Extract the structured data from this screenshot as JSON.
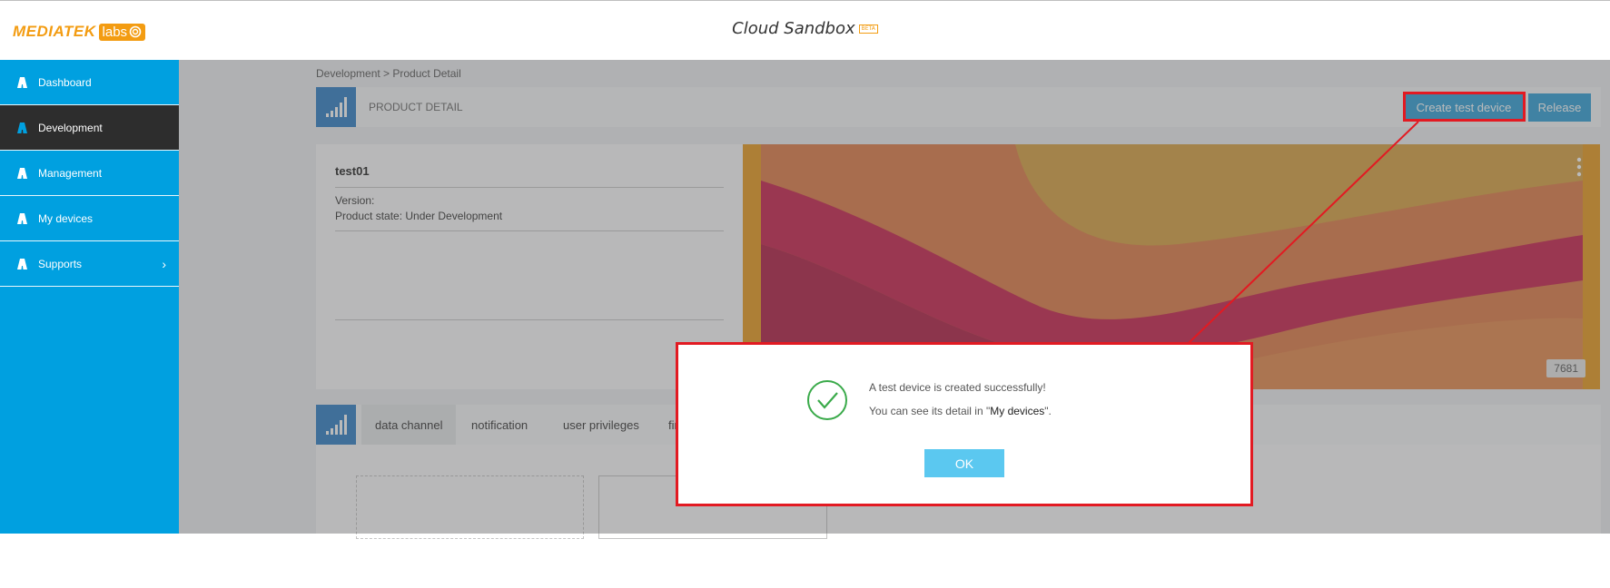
{
  "header": {
    "logo_text": "MEDIATEK",
    "logo_labs": "labs",
    "app_title": "Cloud Sandbox",
    "beta_badge": "BETA"
  },
  "sidebar": {
    "items": [
      {
        "label": "Dashboard"
      },
      {
        "label": "Development"
      },
      {
        "label": "Management"
      },
      {
        "label": "My devices"
      },
      {
        "label": "Supports"
      }
    ]
  },
  "breadcrumb": "Development > Product Detail",
  "product_bar": {
    "title": "PRODUCT DETAIL",
    "create_button": "Create test device",
    "release_button": "Release"
  },
  "product": {
    "name": "test01",
    "version_label": "Version:",
    "state": "Product state: Under Development",
    "banner_badge": "7681"
  },
  "tabs": [
    {
      "label": "data channel"
    },
    {
      "label": "notification"
    },
    {
      "label": "user privileges"
    },
    {
      "label": "firmw"
    }
  ],
  "modal": {
    "message_line1": "A test device is created successfully!",
    "message_line2_prefix": "You can see its detail in \"",
    "message_line2_link": "My devices",
    "message_line2_suffix": "\".",
    "ok_button": "OK"
  },
  "colors": {
    "brand_orange": "#f39c12",
    "sidebar_blue": "#00a0e0",
    "sidebar_active": "#2d2d2d",
    "primary_button": "#2d9fd8",
    "ok_button": "#5bc8f0",
    "highlight_red": "#e21a22",
    "success_green": "#3aaa4a"
  }
}
